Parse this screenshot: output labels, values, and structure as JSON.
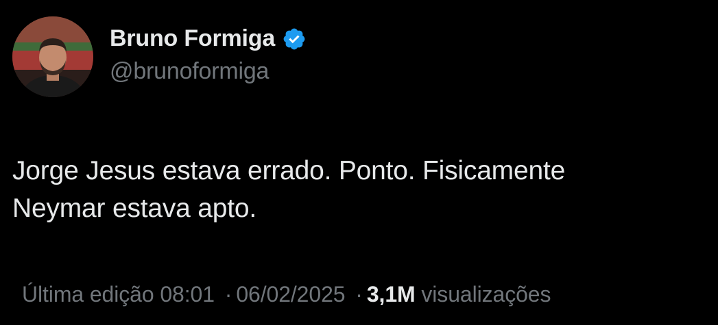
{
  "author": {
    "display_name": "Bruno Formiga",
    "handle": "@brunoformiga",
    "verified_icon": "verified-badge-icon",
    "verified_color": "#1d9bf0"
  },
  "tweet": {
    "lines": [
      "Jorge Jesus estava errado. Ponto. Fisicamente",
      "Neymar estava apto."
    ]
  },
  "meta": {
    "edited_label": "Última edição",
    "time": "08:01",
    "separator": "·",
    "date": "06/02/2025",
    "views_count": "3,1M",
    "views_label": "visualizações"
  },
  "colors": {
    "background": "#000000",
    "primary_text": "#e7e9ea",
    "secondary_text": "#71767b"
  }
}
